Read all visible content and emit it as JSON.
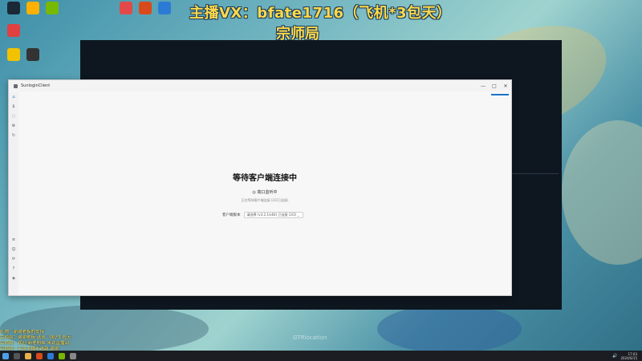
{
  "overlay": {
    "title": "主播VX：bfate1716（飞机*3包天）",
    "subtitle": "宗师局"
  },
  "desktop_icons": [
    {
      "icon": "steam-icon",
      "color": "#1b2838"
    },
    {
      "icon": "app-icon",
      "color": "#ffb000"
    },
    {
      "icon": "nvidia-icon",
      "color": "#76b900"
    },
    {
      "icon": "app-icon",
      "color": "#e24a4a"
    },
    {
      "icon": "game-icon",
      "color": "#d94a1a"
    },
    {
      "icon": "app-icon",
      "color": "#2b7bd6"
    },
    {
      "icon": "app-icon",
      "color": "#e04040"
    },
    {
      "icon": "app-icon",
      "color": "#f2c200"
    },
    {
      "icon": "app-icon",
      "color": "#333"
    }
  ],
  "app_window": {
    "title": "SunloginClient",
    "waiting_title": "等待客户端连接中",
    "status": "◎ 端口监听中",
    "hint": "正在等待客户端连接 (2/2已连接)",
    "client_label": "客户端版本",
    "client_value": "请选择 (v3.2.1/x64) 已连接 (2/2)",
    "controls": {
      "minimize": "—",
      "maximize": "□",
      "close": "✕"
    },
    "sidebar_icons": [
      "home-icon",
      "share-icon",
      "wifi-icon",
      "settings-icon",
      "remote-icon",
      "list-icon",
      "user-icon",
      "sync-icon",
      "help-icon",
      "shield-icon"
    ]
  },
  "watermark": "GTRlocation",
  "chat": [
    "礼物：谢谢老板的支持",
    "宗师局：谢谢老板 送出 飞机*3 包天",
    "宗师局：欢迎 新老粉丝 来到直播间",
    "宗师局：关注主播不迷路 谢谢"
  ],
  "taskbar": {
    "time": "17:03",
    "date": "2024/6/15"
  },
  "colors": {
    "accent": "#1a73c9",
    "overlay_text": "#ffd94a"
  }
}
